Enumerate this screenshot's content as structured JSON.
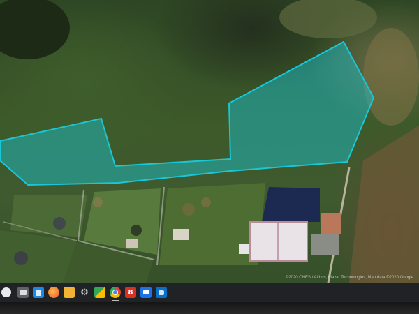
{
  "map": {
    "attribution": "©2020 CNES / Airbus, Maxar Technologies, Map data ©2020 Google",
    "overlay_color": "#19c7d6"
  },
  "taskbar": {
    "icons": [
      {
        "name": "launcher-icon"
      },
      {
        "name": "files-app-icon"
      },
      {
        "name": "docs-app-icon"
      },
      {
        "name": "firefox-icon"
      },
      {
        "name": "folder-icon"
      },
      {
        "name": "settings-icon"
      },
      {
        "name": "maps-app-icon"
      },
      {
        "name": "chrome-icon"
      },
      {
        "name": "calendar-icon",
        "label": "8"
      },
      {
        "name": "remote-desktop-icon"
      },
      {
        "name": "messaging-icon"
      }
    ]
  }
}
